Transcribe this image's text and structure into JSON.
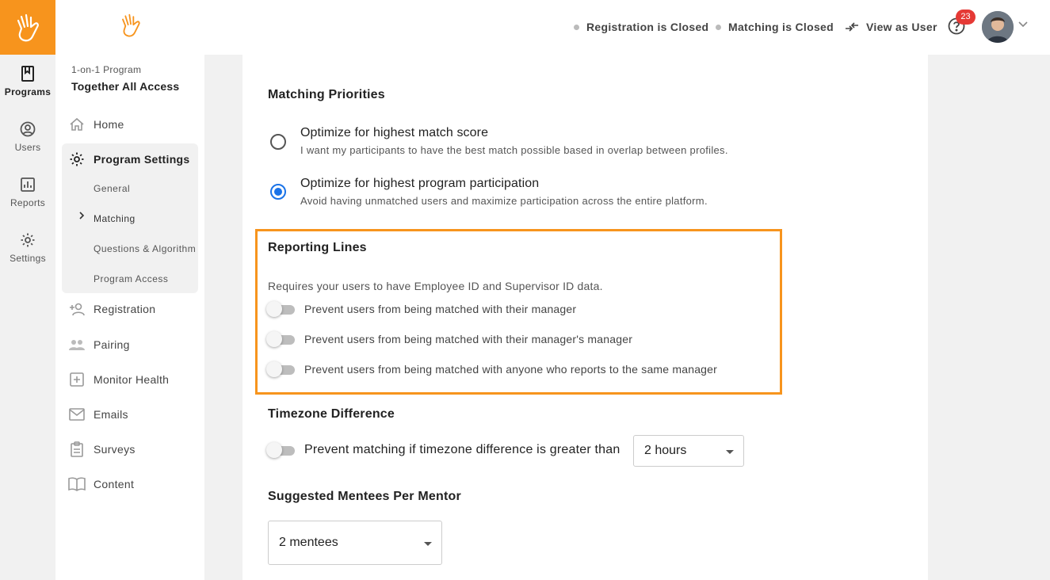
{
  "colors": {
    "brand": "#f7941d",
    "radio_selected": "#1a73e8",
    "badge": "#e53935",
    "highlight_border": "#f7941d"
  },
  "rail": {
    "items": [
      {
        "label": "Programs",
        "icon": "bookmark-icon",
        "active": true
      },
      {
        "label": "Users",
        "icon": "user-circle-icon",
        "active": false
      },
      {
        "label": "Reports",
        "icon": "bar-chart-icon",
        "active": false
      },
      {
        "label": "Settings",
        "icon": "gear-icon",
        "active": false
      }
    ]
  },
  "sidebar": {
    "program_type": "1-on-1 Program",
    "program_name": "Together All Access",
    "nav": [
      {
        "label": "Home",
        "icon": "home-icon"
      },
      {
        "label": "Program Settings",
        "icon": "gear-icon"
      },
      {
        "label": "Registration",
        "icon": "add-user-icon"
      },
      {
        "label": "Pairing",
        "icon": "users-icon"
      },
      {
        "label": "Monitor Health",
        "icon": "plus-square-icon"
      },
      {
        "label": "Emails",
        "icon": "envelope-icon"
      },
      {
        "label": "Surveys",
        "icon": "clipboard-icon"
      },
      {
        "label": "Content",
        "icon": "book-open-icon"
      }
    ],
    "settings_sub": [
      {
        "label": "General"
      },
      {
        "label": "Matching",
        "current": true
      },
      {
        "label": "Questions & Algorithm"
      },
      {
        "label": "Program Access"
      }
    ]
  },
  "topbar": {
    "registration_status": "Registration is Closed",
    "matching_status": "Matching is Closed",
    "view_as_user": "View as User",
    "notification_count": "23"
  },
  "main": {
    "matching_priorities": {
      "heading": "Matching Priorities",
      "options": [
        {
          "title": "Optimize for highest match score",
          "description": "I want my participants to have the best match possible based in overlap between profiles.",
          "selected": false
        },
        {
          "title": "Optimize for highest program participation",
          "description": "Avoid having unmatched users and maximize participation across the entire platform.",
          "selected": true
        }
      ]
    },
    "reporting_lines": {
      "heading": "Reporting Lines",
      "note": "Requires your users to have Employee ID and Supervisor ID data.",
      "toggles": [
        {
          "label": "Prevent users from being matched with their manager",
          "on": false
        },
        {
          "label": "Prevent users from being matched with their manager's manager",
          "on": false
        },
        {
          "label": "Prevent users from being matched with anyone who reports to the same manager",
          "on": false
        }
      ]
    },
    "timezone": {
      "heading": "Timezone Difference",
      "label": "Prevent matching if timezone difference is greater than",
      "on": false,
      "value": "2 hours"
    },
    "mentees": {
      "heading": "Suggested Mentees Per Mentor",
      "value": "2 mentees"
    }
  }
}
